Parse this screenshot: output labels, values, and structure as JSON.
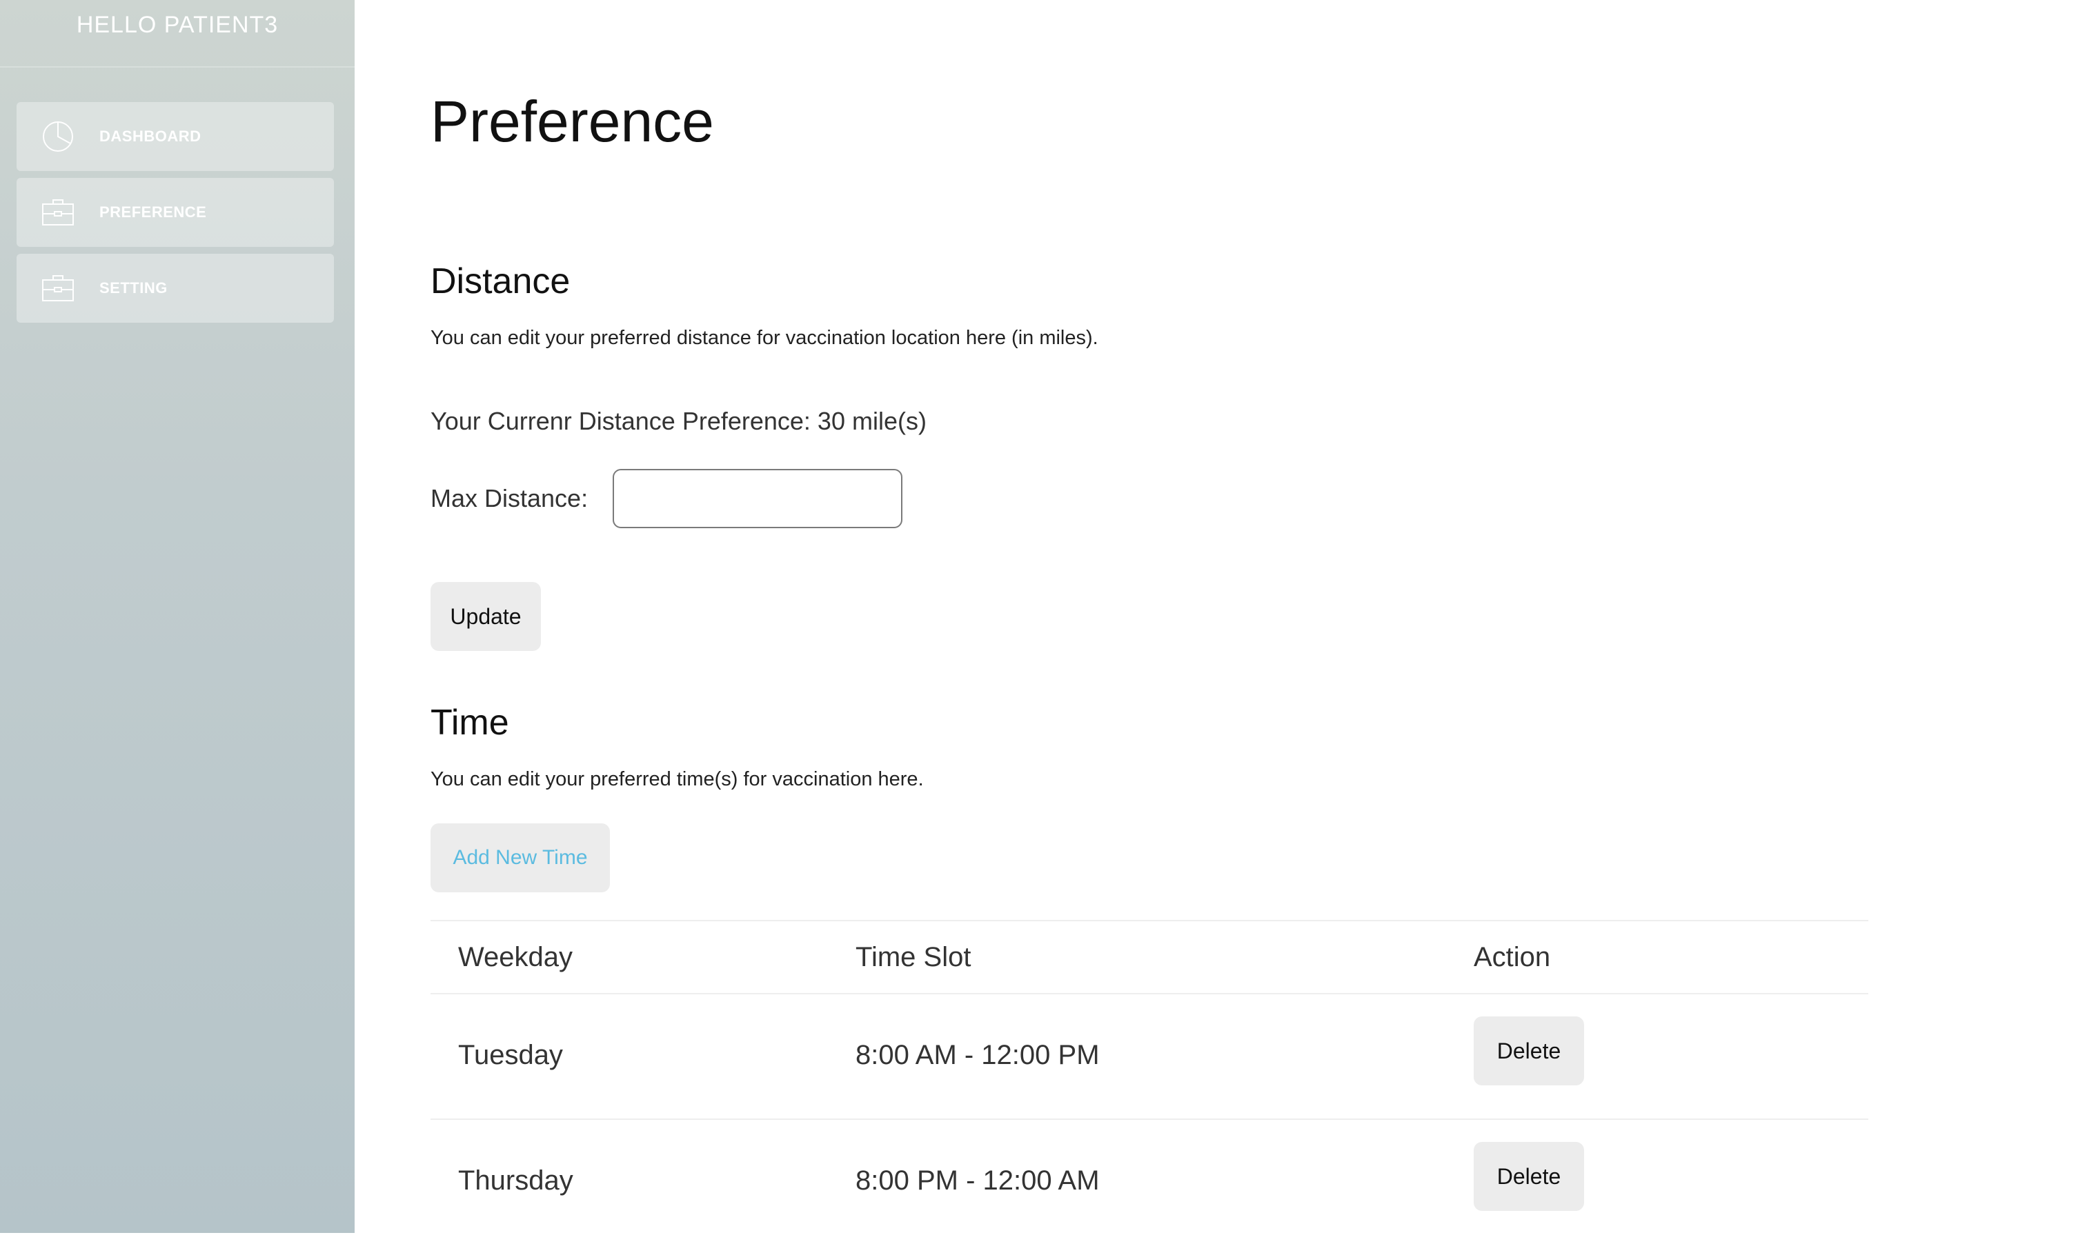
{
  "sidebar": {
    "greeting": "HELLO PATIENT3",
    "items": [
      {
        "label": "DASHBOARD",
        "icon": "pie-chart-icon"
      },
      {
        "label": "PREFERENCE",
        "icon": "briefcase-icon"
      },
      {
        "label": "SETTING",
        "icon": "briefcase-icon"
      }
    ]
  },
  "main": {
    "title": "Preference",
    "distance": {
      "title": "Distance",
      "description": "You can edit your preferred distance for vaccination location here (in miles).",
      "current": "Your Currenr Distance Preference: 30 mile(s)",
      "field_label": "Max Distance:",
      "field_value": "",
      "field_placeholder": "",
      "update_label": "Update"
    },
    "time": {
      "title": "Time",
      "description": "You can edit your preferred time(s) for vaccination here.",
      "add_label": "Add New Time",
      "columns": [
        "Weekday",
        "Time Slot",
        "Action"
      ],
      "rows": [
        {
          "weekday": "Tuesday",
          "slot": "8:00 AM - 12:00 PM",
          "action": "Delete"
        },
        {
          "weekday": "Thursday",
          "slot": "8:00 PM - 12:00 AM",
          "action": "Delete"
        }
      ]
    }
  },
  "colors": {
    "accent_link": "#5bbbe0",
    "button_bg": "#ececec",
    "sidebar_top": "#cdd5d1",
    "sidebar_bottom": "#b5c4c9"
  }
}
